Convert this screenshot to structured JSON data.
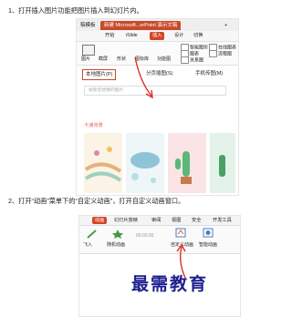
{
  "steps": {
    "step1": "1、打开插入图片功能把图片插入到幻灯片内。",
    "step2": "2、打开“动画”菜单下的“自定义动画”，打开自定义动画窗口。"
  },
  "shot1": {
    "tabs": [
      "稿模板",
      "新建 Microsoft...erPoint 演示文稿",
      "+"
    ],
    "menus": [
      "开始",
      "iSlide",
      "插入",
      "设计",
      "切换"
    ],
    "ribbon": {
      "left_buttons": [
        "图片",
        "截屏",
        "形状",
        "图标库",
        "功能图"
      ],
      "right_buttons": [
        "智能图形",
        "图表",
        "关系图",
        "在线图表",
        "流程图"
      ]
    },
    "panel": {
      "tabs": [
        "本地图片(P)",
        "分页插图(S)",
        "手机传图(M)"
      ],
      "search_placeholder": "搜索您想要的图片",
      "section_title": "卡通背景"
    }
  },
  "shot2": {
    "tabs": [
      "动画",
      "幻灯片放映",
      "审阅",
      "视图",
      "安全",
      "开发工具"
    ],
    "ribbon": {
      "buttons": [
        "飞入",
        "随机动画",
        "自定义动画",
        "智能动画"
      ],
      "value": "00:00.00"
    }
  },
  "watermark": "最需教育"
}
